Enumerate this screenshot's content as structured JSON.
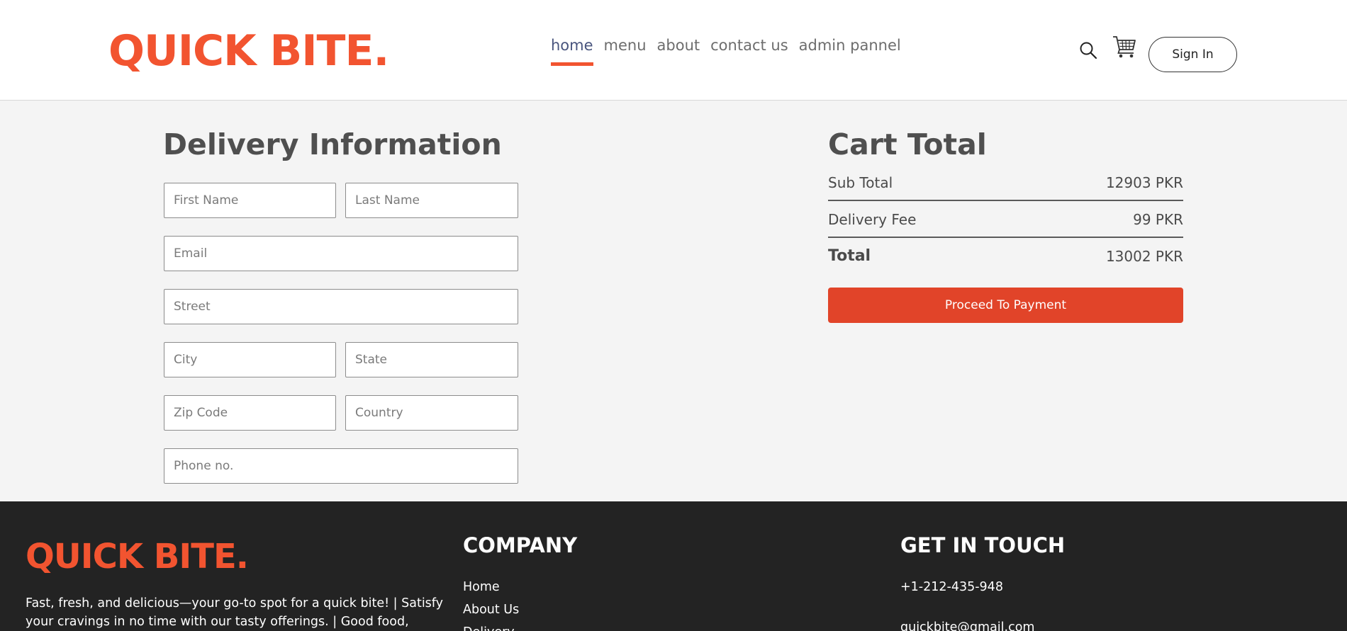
{
  "brand": {
    "logo": "QUICK BITE.",
    "color": "#f25430"
  },
  "nav": {
    "items": [
      {
        "label": "home",
        "active": true
      },
      {
        "label": "menu",
        "active": false
      },
      {
        "label": "about",
        "active": false
      },
      {
        "label": "contact us",
        "active": false
      },
      {
        "label": "admin pannel",
        "active": false
      }
    ],
    "search_icon": "search-icon",
    "cart_icon": "cart-icon",
    "signin_label": "Sign In"
  },
  "delivery": {
    "title": "Delivery Information",
    "fields": {
      "first_name": "First Name",
      "last_name": "Last Name",
      "email": "Email",
      "street": "Street",
      "city": "City",
      "state": "State",
      "zip": "Zip Code",
      "country": "Country",
      "phone": "Phone no."
    }
  },
  "cart": {
    "title": "Cart Total",
    "subtotal_label": "Sub Total",
    "subtotal_value": "12903 PKR",
    "delivery_label": "Delivery Fee",
    "delivery_value": "99 PKR",
    "total_label": "Total",
    "total_value": "13002 PKR",
    "pay_button": "Proceed To Payment",
    "button_color": "#e14429"
  },
  "footer": {
    "logo": "QUICK BITE.",
    "description": "Fast, fresh, and delicious—your go-to spot for a quick bite! | Satisfy your cravings in no time with our tasty offerings. | Good food, quick",
    "company_title": "COMPANY",
    "company_links": [
      "Home",
      "About Us",
      "Delivery"
    ],
    "contact_title": "GET IN TOUCH",
    "phone": "+1-212-435-948",
    "email": "quickbite@gmail.com"
  }
}
